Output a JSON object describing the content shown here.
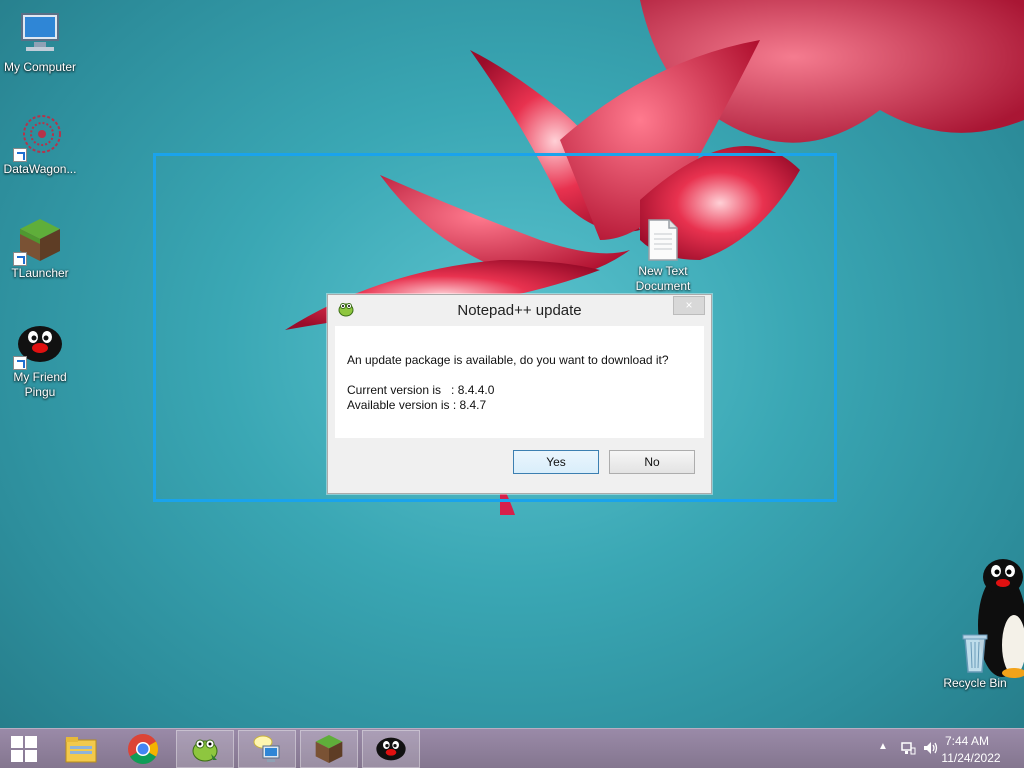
{
  "desktop": {
    "icons": [
      {
        "label": "My Computer"
      },
      {
        "label": "DataWagon..."
      },
      {
        "label": "TLauncher"
      },
      {
        "label": "My Friend Pingu"
      },
      {
        "label": "New Text Document"
      },
      {
        "label": "Recycle Bin"
      }
    ]
  },
  "dialog": {
    "title": "Notepad++ update",
    "close_label": "×",
    "message": "An update package is available, do you want to download it?",
    "current_version": "Current version is   : 8.4.4.0",
    "available_version": "Available version is : 8.4.7",
    "yes_label": "Yes",
    "no_label": "No"
  },
  "taskbar": {
    "items": [
      {
        "icon": "file-explorer-icon"
      },
      {
        "icon": "chrome-icon"
      },
      {
        "icon": "notepad-plus-plus-icon"
      },
      {
        "icon": "update-computer-icon"
      },
      {
        "icon": "minecraft-icon"
      },
      {
        "icon": "pingu-icon"
      }
    ],
    "tray": {
      "time": "7:44 AM",
      "date": "11/24/2022"
    }
  },
  "colors": {
    "selection": "#1aa3ec",
    "taskbar": "#8e7f9b",
    "accent": "#3c7fb1"
  }
}
